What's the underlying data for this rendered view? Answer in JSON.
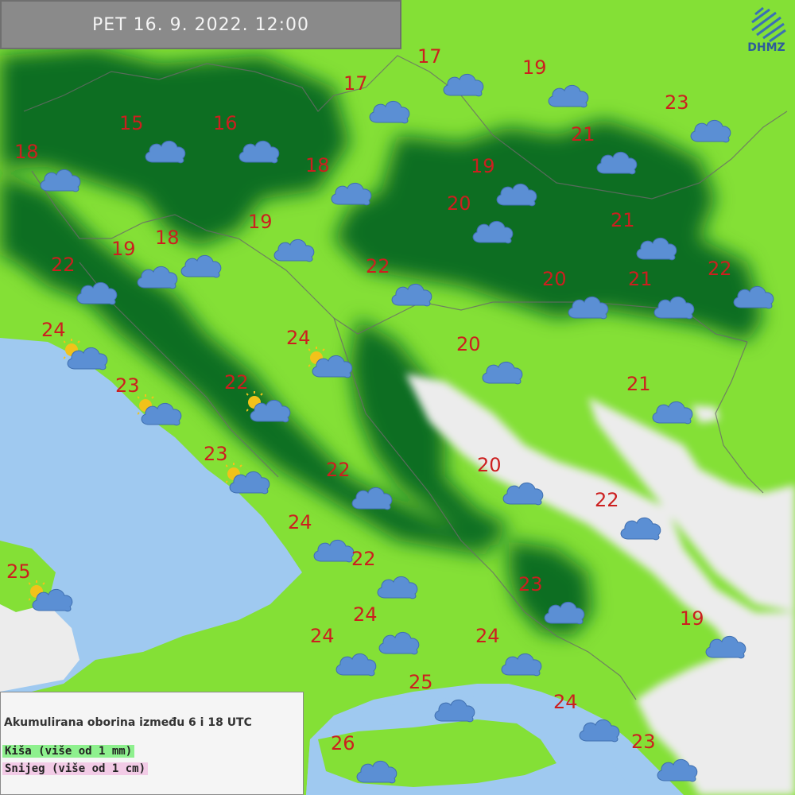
{
  "header": {
    "datetime": "PET  16. 9. 2022. 12:00"
  },
  "logo": {
    "text": "DHMZ"
  },
  "legend": {
    "title": "Akumulirana oborina između 6 i 18 UTC",
    "rain": "Kiša (više od 1 mm)",
    "snow": "Snijeg (više od 1 cm)"
  },
  "colors": {
    "sea": "#9fc9f0",
    "land_light": "#84e036",
    "land_dark": "#0e6e20",
    "mountain": "#ececec",
    "temp_text": "#cc1f1f",
    "cloud": "#5b8fd4",
    "sun": "#f2c21a"
  },
  "stations": [
    {
      "temp": "17",
      "icon": "cloud-icon"
    },
    {
      "temp": "19",
      "icon": "cloud-icon"
    },
    {
      "temp": "17",
      "icon": "cloud-icon"
    },
    {
      "temp": "23",
      "icon": "cloud-icon"
    },
    {
      "temp": "15",
      "icon": "cloud-icon"
    },
    {
      "temp": "16",
      "icon": "cloud-icon"
    },
    {
      "temp": "21",
      "icon": "cloud-icon"
    },
    {
      "temp": "18",
      "icon": "cloud-icon"
    },
    {
      "temp": "18",
      "icon": "cloud-icon"
    },
    {
      "temp": "19",
      "icon": "cloud-icon"
    },
    {
      "temp": "20",
      "icon": "cloud-icon"
    },
    {
      "temp": "21",
      "icon": "cloud-icon"
    },
    {
      "temp": "19",
      "icon": "cloud-icon"
    },
    {
      "temp": "18",
      "icon": "cloud-icon"
    },
    {
      "temp": "19",
      "icon": "cloud-icon"
    },
    {
      "temp": "22",
      "icon": "cloud-icon"
    },
    {
      "temp": "22",
      "icon": "cloud-icon"
    },
    {
      "temp": "20",
      "icon": "cloud-icon"
    },
    {
      "temp": "21",
      "icon": "cloud-icon"
    },
    {
      "temp": "22",
      "icon": "cloud-icon"
    },
    {
      "temp": "24",
      "icon": "sun-cloud-icon"
    },
    {
      "temp": "24",
      "icon": "sun-cloud-icon"
    },
    {
      "temp": "20",
      "icon": "cloud-icon"
    },
    {
      "temp": "23",
      "icon": "sun-cloud-icon"
    },
    {
      "temp": "22",
      "icon": "sun-cloud-icon"
    },
    {
      "temp": "21",
      "icon": "cloud-icon"
    },
    {
      "temp": "23",
      "icon": "sun-cloud-icon"
    },
    {
      "temp": "20",
      "icon": "cloud-icon"
    },
    {
      "temp": "22",
      "icon": "cloud-icon"
    },
    {
      "temp": "22",
      "icon": "cloud-icon"
    },
    {
      "temp": "24",
      "icon": "cloud-icon"
    },
    {
      "temp": "25",
      "icon": "sun-cloud-icon"
    },
    {
      "temp": "22",
      "icon": "cloud-icon"
    },
    {
      "temp": "23",
      "icon": "cloud-icon"
    },
    {
      "temp": "24",
      "icon": "cloud-icon"
    },
    {
      "temp": "19",
      "icon": "cloud-icon"
    },
    {
      "temp": "24",
      "icon": "cloud-icon"
    },
    {
      "temp": "24",
      "icon": "cloud-icon"
    },
    {
      "temp": "25",
      "icon": "cloud-icon"
    },
    {
      "temp": "24",
      "icon": "cloud-icon"
    },
    {
      "temp": "26",
      "icon": "cloud-icon"
    },
    {
      "temp": "23",
      "icon": "cloud-icon"
    }
  ]
}
